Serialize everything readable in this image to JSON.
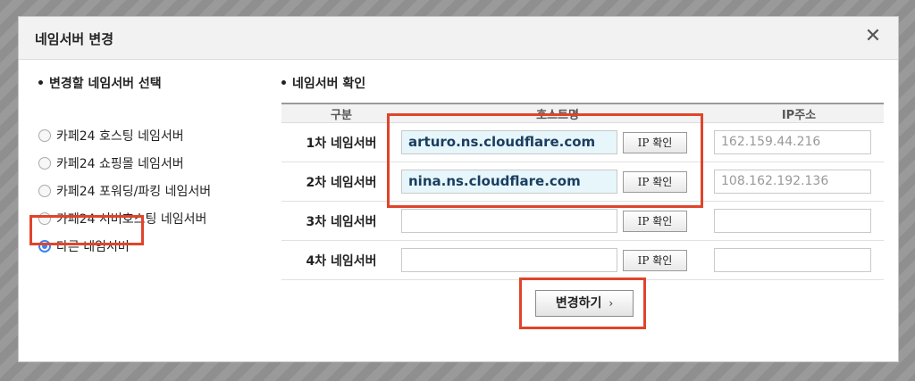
{
  "dialog": {
    "title": "네임서버 변경",
    "close_icon": "close-icon"
  },
  "left": {
    "section_title": "변경할 네임서버 선택",
    "options": [
      {
        "label": "카페24 호스팅 네임서버",
        "selected": false
      },
      {
        "label": "카페24 쇼핑몰 네임서버",
        "selected": false
      },
      {
        "label": "카페24 포워딩/파킹 네임서버",
        "selected": false
      },
      {
        "label": "카페24 서버호스팅 네임서버",
        "selected": false
      },
      {
        "label": "다른 네임서버",
        "selected": true
      }
    ]
  },
  "right": {
    "section_title": "네임서버 확인",
    "columns": [
      "구분",
      "호스트명",
      "IP주소"
    ],
    "rows": [
      {
        "label": "1차 네임서버",
        "host": "arturo.ns.cloudflare.com",
        "button": "IP 확인",
        "ip": "162.159.44.216"
      },
      {
        "label": "2차 네임서버",
        "host": "nina.ns.cloudflare.com",
        "button": "IP 확인",
        "ip": "108.162.192.136"
      },
      {
        "label": "3차 네임서버",
        "host": "",
        "button": "IP 확인",
        "ip": ""
      },
      {
        "label": "4차 네임서버",
        "host": "",
        "button": "IP 확인",
        "ip": ""
      }
    ],
    "submit_label": "변경하기",
    "submit_icon": "chevron-right-icon"
  },
  "colors": {
    "highlight": "#e0442b",
    "radio_selected": "#3b82f6",
    "filled_input_bg": "#e6f6fb"
  }
}
